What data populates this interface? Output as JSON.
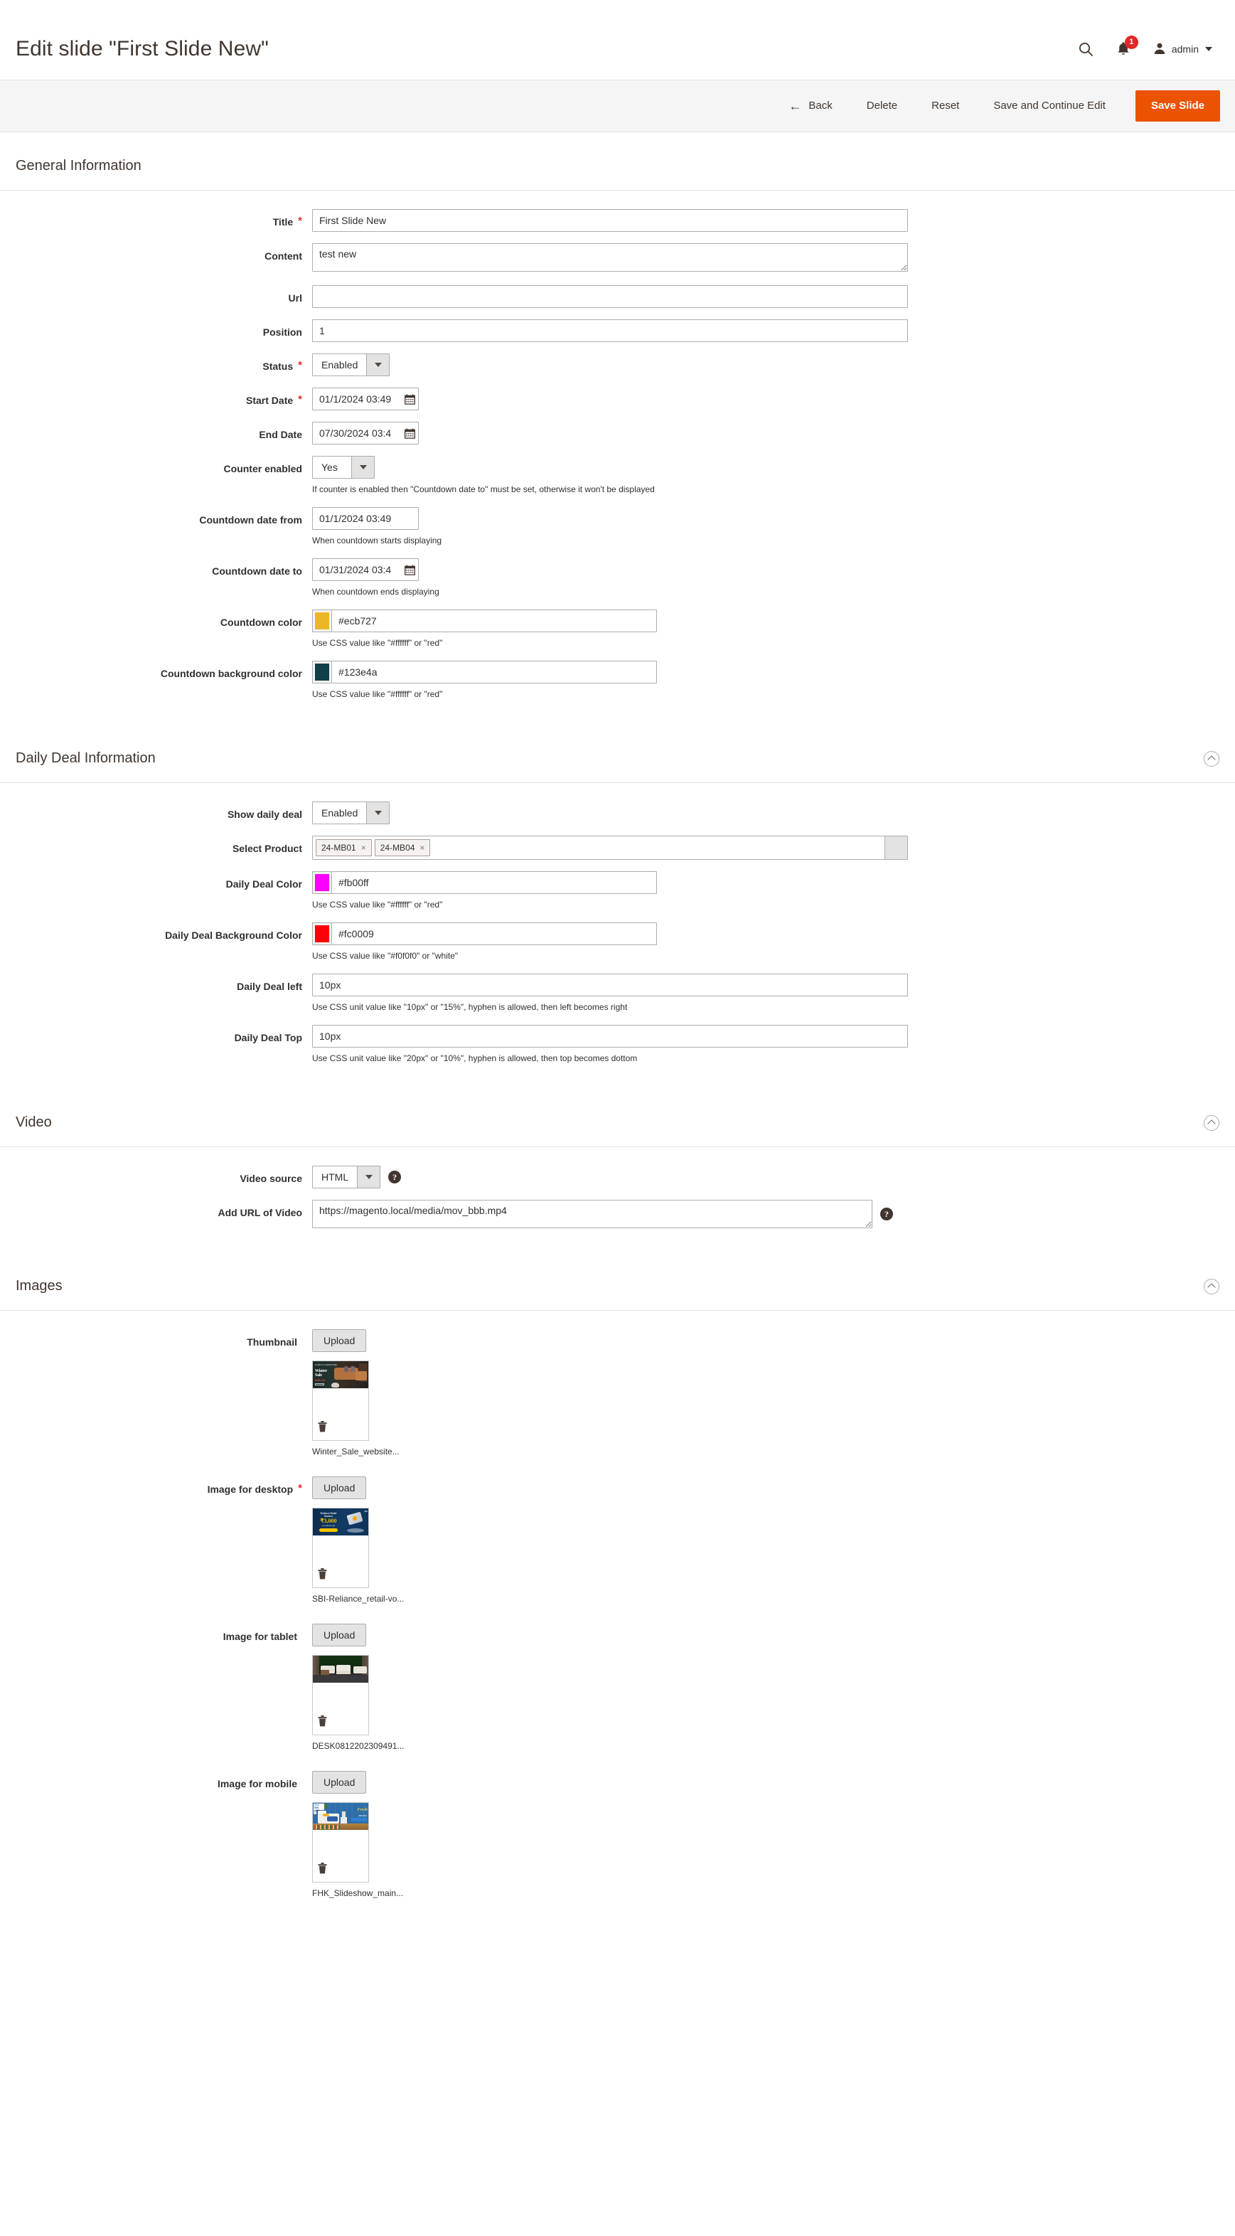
{
  "header": {
    "title": "Edit slide \"First Slide New\"",
    "search_icon": "search-icon",
    "notifications_icon": "bell-icon",
    "notifications_count": "1",
    "admin_label": "admin"
  },
  "toolbar": {
    "back_label": "Back",
    "back_arrow": "←",
    "delete_label": "Delete",
    "reset_label": "Reset",
    "save_continue_label": "Save and Continue Edit",
    "save_label": "Save Slide",
    "primary_color": "#eb5202"
  },
  "sections": {
    "general": {
      "title": "General Information",
      "fields": {
        "title": {
          "label": "Title",
          "value": "First Slide New",
          "required": "*"
        },
        "content": {
          "label": "Content",
          "value": "test new"
        },
        "url": {
          "label": "Url",
          "value": ""
        },
        "position": {
          "label": "Position",
          "value": "1"
        },
        "status": {
          "label": "Status",
          "value": "Enabled",
          "required": "*"
        },
        "start_date": {
          "label": "Start Date",
          "value": "01/1/2024 03:49",
          "required": "*"
        },
        "end_date": {
          "label": "End Date",
          "value": "07/30/2024 03:4"
        },
        "counter_enabled": {
          "label": "Counter enabled",
          "value": "Yes",
          "note": "If counter is enabled then \"Countdown date to\" must be set, otherwise it won't be displayed"
        },
        "countdown_from": {
          "label": "Countdown date from",
          "value": "01/1/2024 03:49",
          "note": "When countdown starts displaying"
        },
        "countdown_to": {
          "label": "Countdown date to",
          "value": "01/31/2024 03:4",
          "note": "When countdown ends displaying"
        },
        "countdown_color": {
          "label": "Countdown color",
          "value": "#ecb727",
          "swatch": "#ecb727",
          "note": "Use CSS value like \"#ffffff\" or \"red\""
        },
        "countdown_bg_color": {
          "label": "Countdown background color",
          "value": "#123e4a",
          "swatch": "#123e4a",
          "note": "Use CSS value like \"#ffffff\" or \"red\""
        }
      }
    },
    "daily_deal": {
      "title": "Daily Deal Information",
      "fields": {
        "show_daily_deal": {
          "label": "Show daily deal",
          "value": "Enabled"
        },
        "select_product": {
          "label": "Select Product",
          "tokens": [
            "24-MB01",
            "24-MB04"
          ],
          "remove_glyph": "×"
        },
        "deal_color": {
          "label": "Daily Deal Color",
          "value": "#fb00ff",
          "swatch": "#fb00ff",
          "note": "Use CSS value like \"#ffffff\" or \"red\""
        },
        "deal_bg_color": {
          "label": "Daily Deal Background Color",
          "value": "#fc0009",
          "swatch": "#fc0009",
          "note": "Use CSS value like \"#f0f0f0\" or \"white\""
        },
        "deal_left": {
          "label": "Daily Deal left",
          "value": "10px",
          "note": "Use CSS unit value like \"10px\" or \"15%\", hyphen is allowed, then left becomes right"
        },
        "deal_top": {
          "label": "Daily Deal Top",
          "value": "10px",
          "note": "Use CSS unit value like \"20px\" or \"10%\", hyphen is allowed, then top becomes dottom"
        }
      }
    },
    "video": {
      "title": "Video",
      "fields": {
        "video_source": {
          "label": "Video source",
          "value": "HTML",
          "help": "?"
        },
        "video_url": {
          "label": "Add URL of Video",
          "value": "https://magento.local/media/mov_bbb.mp4",
          "help": "?"
        }
      }
    },
    "images": {
      "title": "Images",
      "upload_label": "Upload",
      "items": [
        {
          "label": "Thumbnail",
          "required": "",
          "filename": "Winter_Sale_website...",
          "art": "winter",
          "delete_icon": "trash-icon"
        },
        {
          "label": "Image for desktop",
          "required": "*",
          "filename": "SBI-Reliance_retail-vo...",
          "art": "sbi",
          "delete_icon": "trash-icon"
        },
        {
          "label": "Image for tablet",
          "required": "",
          "filename": "DESK0812202309491...",
          "art": "desk",
          "delete_icon": "trash-icon"
        },
        {
          "label": "Image for mobile",
          "required": "",
          "filename": "FHK_Slideshow_main...",
          "art": "fhk",
          "delete_icon": "trash-icon"
        }
      ]
    }
  }
}
